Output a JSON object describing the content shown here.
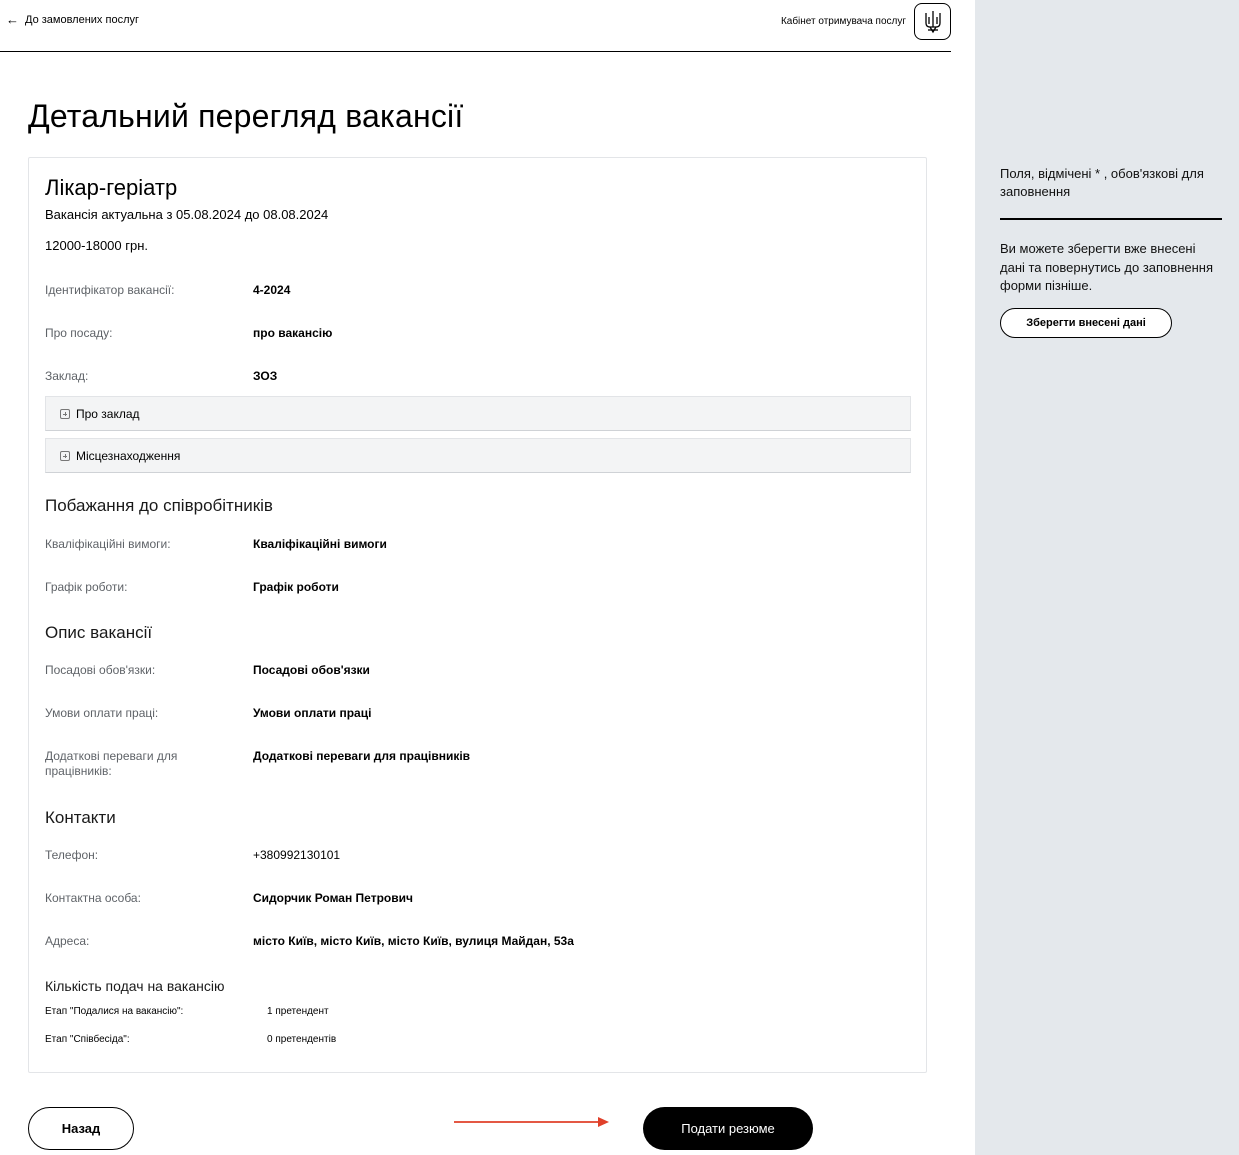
{
  "header": {
    "back_label": "До замовлених послуг",
    "cabinet_label": "Кабінет отримувача послуг"
  },
  "page_title": "Детальний перегляд вакансії",
  "vacancy": {
    "title": "Лікар-геріатр",
    "period": "Вакансія актуальна з 05.08.2024 до 08.08.2024",
    "salary": "12000-18000 грн.",
    "fields": [
      {
        "label": "Ідентифікатор вакансії:",
        "value": "4-2024"
      },
      {
        "label": "Про посаду:",
        "value": "про вакансію"
      },
      {
        "label": "Заклад:",
        "value": "ЗОЗ"
      }
    ],
    "accordions": [
      "Про заклад",
      "Місцезнаходження"
    ]
  },
  "wishes": {
    "heading": "Побажання до співробітників",
    "fields": [
      {
        "label": "Кваліфікаційні вимоги:",
        "value": "Кваліфікаційні вимоги"
      },
      {
        "label": "Графік роботи:",
        "value": "Графік роботи"
      }
    ]
  },
  "description": {
    "heading": "Опис вакансії",
    "fields": [
      {
        "label": "Посадові обов'язки:",
        "value": "Посадові обов'язки"
      },
      {
        "label": "Умови оплати праці:",
        "value": "Умови оплати праці"
      },
      {
        "label": "Додаткові переваги для працівників:",
        "value": "Додаткові переваги для працівників"
      }
    ]
  },
  "contacts": {
    "heading": "Контакти",
    "fields": [
      {
        "label": "Телефон:",
        "value": "+380992130101"
      },
      {
        "label": "Контактна особа:",
        "value": "Сидорчик Роман Петрович"
      },
      {
        "label": "Адреса:",
        "value": "місто Київ, місто Київ, місто Київ, вулиця Майдан, 53а"
      }
    ]
  },
  "applications": {
    "heading": "Кількість подач на вакансію",
    "stages": [
      {
        "label": "Етап \"Подалися на вакансію\":",
        "value": "1 претендент"
      },
      {
        "label": "Етап \"Співбесіда\":",
        "value": "0 претендентів"
      }
    ]
  },
  "buttons": {
    "back": "Назад",
    "submit": "Подати резюме"
  },
  "side_panel": {
    "required_note": "Поля, відмічені * , обов'язкові для заповнення",
    "save_hint": "Ви можете зберегти вже внесені дані та повернутись до заповнення форми пізніше.",
    "save_button": "Зберегти внесені дані"
  },
  "colors": {
    "side_bg": "#e4e8ec",
    "accent_arrow": "#e0402a",
    "primary_button": "#000000"
  }
}
